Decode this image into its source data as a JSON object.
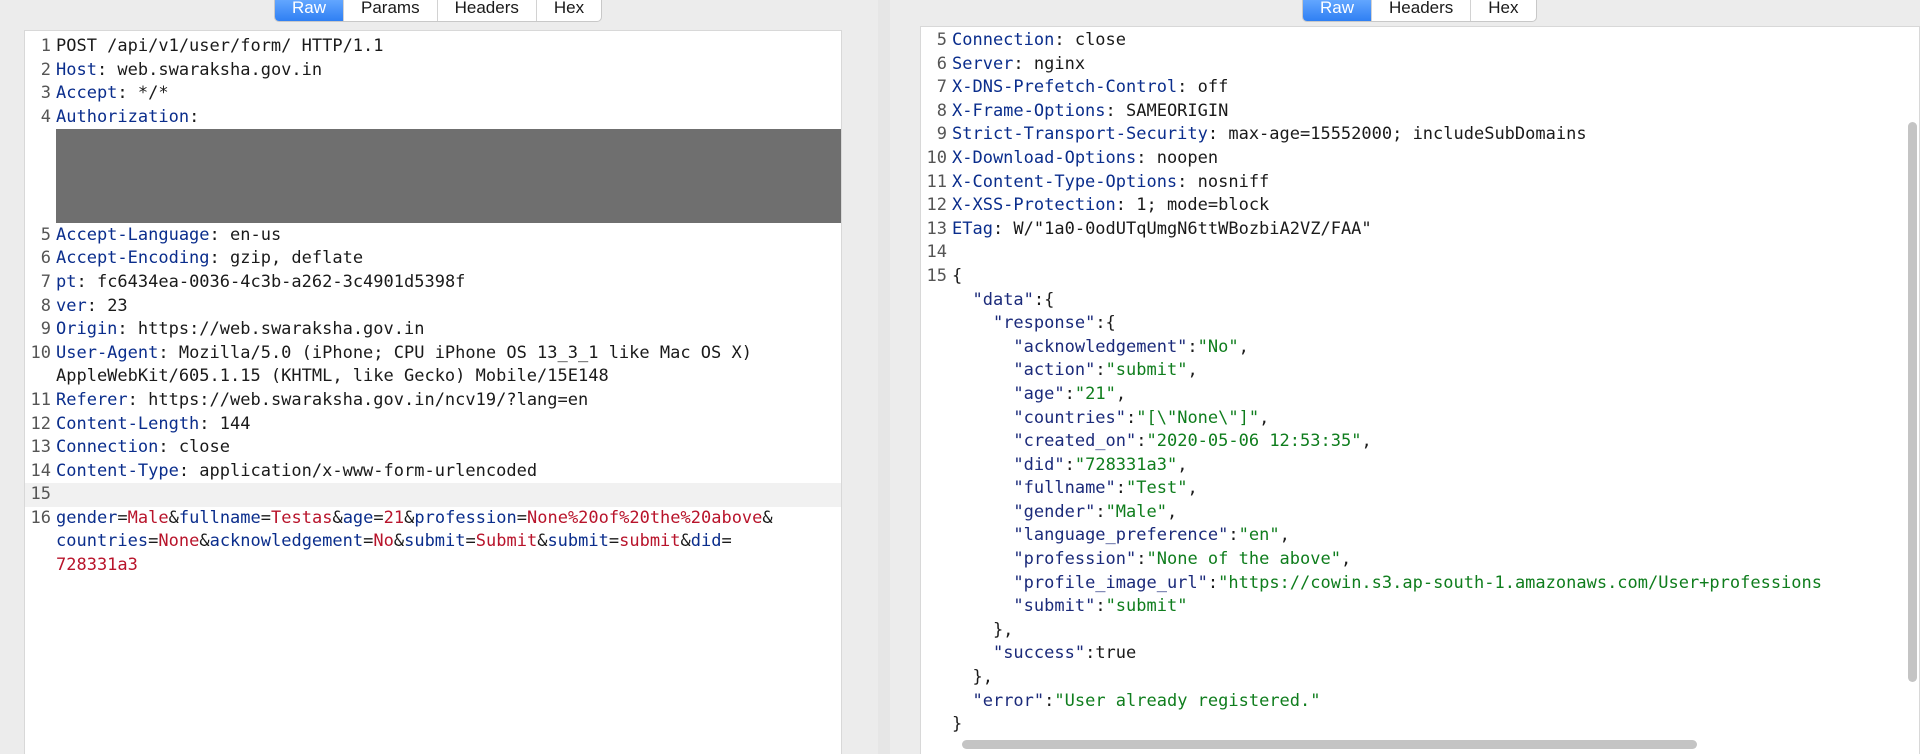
{
  "request": {
    "tabs": [
      "Raw",
      "Params",
      "Headers",
      "Hex"
    ],
    "active_tab": "Raw",
    "lines": [
      {
        "n": "1",
        "segments": [
          {
            "t": "POST /api/v1/user/form/ HTTP/1.1",
            "c": "plain"
          }
        ]
      },
      {
        "n": "2",
        "segments": [
          {
            "t": "Host",
            "c": "k"
          },
          {
            "t": ": web.swaraksha.gov.in",
            "c": "plain"
          }
        ]
      },
      {
        "n": "3",
        "segments": [
          {
            "t": "Accept",
            "c": "k"
          },
          {
            "t": ": */*",
            "c": "plain"
          }
        ]
      },
      {
        "n": "4",
        "segments": [
          {
            "t": "Authorization",
            "c": "k"
          },
          {
            "t": ":",
            "c": "plain"
          }
        ]
      },
      {
        "n": "",
        "redacted": true,
        "segments": []
      },
      {
        "n": "",
        "segments": []
      },
      {
        "n": "",
        "segments": []
      },
      {
        "n": "",
        "segments": []
      },
      {
        "n": "5",
        "segments": [
          {
            "t": "Accept-Language",
            "c": "k"
          },
          {
            "t": ": en-us",
            "c": "plain"
          }
        ]
      },
      {
        "n": "6",
        "segments": [
          {
            "t": "Accept-Encoding",
            "c": "k"
          },
          {
            "t": ": gzip, deflate",
            "c": "plain"
          }
        ]
      },
      {
        "n": "7",
        "segments": [
          {
            "t": "pt",
            "c": "k"
          },
          {
            "t": ": fc6434ea-0036-4c3b-a262-3c4901d5398f",
            "c": "plain"
          }
        ]
      },
      {
        "n": "8",
        "segments": [
          {
            "t": "ver",
            "c": "k"
          },
          {
            "t": ": 23",
            "c": "plain"
          }
        ]
      },
      {
        "n": "9",
        "segments": [
          {
            "t": "Origin",
            "c": "k"
          },
          {
            "t": ": https://web.swaraksha.gov.in",
            "c": "plain"
          }
        ]
      },
      {
        "n": "10",
        "segments": [
          {
            "t": "User-Agent",
            "c": "k"
          },
          {
            "t": ": Mozilla/5.0 (iPhone; CPU iPhone OS 13_3_1 like Mac OS X)",
            "c": "plain"
          }
        ]
      },
      {
        "n": "",
        "segments": [
          {
            "t": "AppleWebKit/605.1.15 (KHTML, like Gecko) Mobile/15E148",
            "c": "plain"
          }
        ]
      },
      {
        "n": "11",
        "segments": [
          {
            "t": "Referer",
            "c": "k"
          },
          {
            "t": ": https://web.swaraksha.gov.in/ncv19/?lang=en",
            "c": "plain"
          }
        ]
      },
      {
        "n": "12",
        "segments": [
          {
            "t": "Content-Length",
            "c": "k"
          },
          {
            "t": ": 144",
            "c": "plain"
          }
        ]
      },
      {
        "n": "13",
        "segments": [
          {
            "t": "Connection",
            "c": "k"
          },
          {
            "t": ": close",
            "c": "plain"
          }
        ]
      },
      {
        "n": "14",
        "segments": [
          {
            "t": "Content-Type",
            "c": "k"
          },
          {
            "t": ": application/x-www-form-urlencoded",
            "c": "plain"
          }
        ]
      },
      {
        "n": "15",
        "highlight": true,
        "segments": []
      },
      {
        "n": "16",
        "segments": [
          {
            "t": "gender",
            "c": "pn"
          },
          {
            "t": "=",
            "c": "plain"
          },
          {
            "t": "Male",
            "c": "pv"
          },
          {
            "t": "&",
            "c": "plain"
          },
          {
            "t": "fullname",
            "c": "pn"
          },
          {
            "t": "=",
            "c": "plain"
          },
          {
            "t": "Testas",
            "c": "pv"
          },
          {
            "t": "&",
            "c": "plain"
          },
          {
            "t": "age",
            "c": "pn"
          },
          {
            "t": "=",
            "c": "plain"
          },
          {
            "t": "21",
            "c": "pv"
          },
          {
            "t": "&",
            "c": "plain"
          },
          {
            "t": "profession",
            "c": "pn"
          },
          {
            "t": "=",
            "c": "plain"
          },
          {
            "t": "None%20of%20the%20above",
            "c": "pv"
          },
          {
            "t": "&",
            "c": "plain"
          }
        ]
      },
      {
        "n": "",
        "segments": [
          {
            "t": "countries",
            "c": "pn"
          },
          {
            "t": "=",
            "c": "plain"
          },
          {
            "t": "None",
            "c": "pv"
          },
          {
            "t": "&",
            "c": "plain"
          },
          {
            "t": "acknowledgement",
            "c": "pn"
          },
          {
            "t": "=",
            "c": "plain"
          },
          {
            "t": "No",
            "c": "pv"
          },
          {
            "t": "&",
            "c": "plain"
          },
          {
            "t": "submit",
            "c": "pn"
          },
          {
            "t": "=",
            "c": "plain"
          },
          {
            "t": "Submit",
            "c": "pv"
          },
          {
            "t": "&",
            "c": "plain"
          },
          {
            "t": "submit",
            "c": "pn"
          },
          {
            "t": "=",
            "c": "plain"
          },
          {
            "t": "submit",
            "c": "pv"
          },
          {
            "t": "&",
            "c": "plain"
          },
          {
            "t": "did",
            "c": "pn"
          },
          {
            "t": "=",
            "c": "plain"
          }
        ]
      },
      {
        "n": "",
        "segments": [
          {
            "t": "728331a3",
            "c": "pv"
          }
        ]
      }
    ]
  },
  "response": {
    "tabs": [
      "Raw",
      "Headers",
      "Hex"
    ],
    "active_tab": "Raw",
    "lines": [
      {
        "n": "5",
        "segments": [
          {
            "t": "Connection",
            "c": "k"
          },
          {
            "t": ": close",
            "c": "plain"
          }
        ]
      },
      {
        "n": "6",
        "segments": [
          {
            "t": "Server",
            "c": "k"
          },
          {
            "t": ": nginx",
            "c": "plain"
          }
        ]
      },
      {
        "n": "7",
        "segments": [
          {
            "t": "X-DNS-Prefetch-Control",
            "c": "k"
          },
          {
            "t": ": off",
            "c": "plain"
          }
        ]
      },
      {
        "n": "8",
        "segments": [
          {
            "t": "X-Frame-Options",
            "c": "k"
          },
          {
            "t": ": SAMEORIGIN",
            "c": "plain"
          }
        ]
      },
      {
        "n": "9",
        "segments": [
          {
            "t": "Strict-Transport-Security",
            "c": "k"
          },
          {
            "t": ": max-age=15552000; includeSubDomains",
            "c": "plain"
          }
        ]
      },
      {
        "n": "10",
        "segments": [
          {
            "t": "X-Download-Options",
            "c": "k"
          },
          {
            "t": ": noopen",
            "c": "plain"
          }
        ]
      },
      {
        "n": "11",
        "segments": [
          {
            "t": "X-Content-Type-Options",
            "c": "k"
          },
          {
            "t": ": nosniff",
            "c": "plain"
          }
        ]
      },
      {
        "n": "12",
        "segments": [
          {
            "t": "X-XSS-Protection",
            "c": "k"
          },
          {
            "t": ": 1; mode=block",
            "c": "plain"
          }
        ]
      },
      {
        "n": "13",
        "segments": [
          {
            "t": "ETag",
            "c": "k"
          },
          {
            "t": ": W/\"1a0-0odUTqUmgN6ttWBozbiA2VZ/FAA\"",
            "c": "plain"
          }
        ]
      },
      {
        "n": "14",
        "segments": []
      },
      {
        "n": "15",
        "segments": [
          {
            "t": "{",
            "c": "plain"
          }
        ]
      },
      {
        "n": "",
        "segments": [
          {
            "t": "  ",
            "c": "plain"
          },
          {
            "t": "\"data\"",
            "c": "jk"
          },
          {
            "t": ":{",
            "c": "plain"
          }
        ]
      },
      {
        "n": "",
        "segments": [
          {
            "t": "    ",
            "c": "plain"
          },
          {
            "t": "\"response\"",
            "c": "jk"
          },
          {
            "t": ":{",
            "c": "plain"
          }
        ]
      },
      {
        "n": "",
        "segments": [
          {
            "t": "      ",
            "c": "plain"
          },
          {
            "t": "\"acknowledgement\"",
            "c": "jk"
          },
          {
            "t": ":",
            "c": "plain"
          },
          {
            "t": "\"No\"",
            "c": "jv"
          },
          {
            "t": ",",
            "c": "plain"
          }
        ]
      },
      {
        "n": "",
        "segments": [
          {
            "t": "      ",
            "c": "plain"
          },
          {
            "t": "\"action\"",
            "c": "jk"
          },
          {
            "t": ":",
            "c": "plain"
          },
          {
            "t": "\"submit\"",
            "c": "jv"
          },
          {
            "t": ",",
            "c": "plain"
          }
        ]
      },
      {
        "n": "",
        "segments": [
          {
            "t": "      ",
            "c": "plain"
          },
          {
            "t": "\"age\"",
            "c": "jk"
          },
          {
            "t": ":",
            "c": "plain"
          },
          {
            "t": "\"21\"",
            "c": "jv"
          },
          {
            "t": ",",
            "c": "plain"
          }
        ]
      },
      {
        "n": "",
        "segments": [
          {
            "t": "      ",
            "c": "plain"
          },
          {
            "t": "\"countries\"",
            "c": "jk"
          },
          {
            "t": ":",
            "c": "plain"
          },
          {
            "t": "\"[\\\"None\\\"]\"",
            "c": "jv"
          },
          {
            "t": ",",
            "c": "plain"
          }
        ]
      },
      {
        "n": "",
        "segments": [
          {
            "t": "      ",
            "c": "plain"
          },
          {
            "t": "\"created_on\"",
            "c": "jk"
          },
          {
            "t": ":",
            "c": "plain"
          },
          {
            "t": "\"2020-05-06 12:53:35\"",
            "c": "jv"
          },
          {
            "t": ",",
            "c": "plain"
          }
        ]
      },
      {
        "n": "",
        "segments": [
          {
            "t": "      ",
            "c": "plain"
          },
          {
            "t": "\"did\"",
            "c": "jk"
          },
          {
            "t": ":",
            "c": "plain"
          },
          {
            "t": "\"728331a3\"",
            "c": "jv"
          },
          {
            "t": ",",
            "c": "plain"
          }
        ]
      },
      {
        "n": "",
        "segments": [
          {
            "t": "      ",
            "c": "plain"
          },
          {
            "t": "\"fullname\"",
            "c": "jk"
          },
          {
            "t": ":",
            "c": "plain"
          },
          {
            "t": "\"Test\"",
            "c": "jv"
          },
          {
            "t": ",",
            "c": "plain"
          }
        ]
      },
      {
        "n": "",
        "segments": [
          {
            "t": "      ",
            "c": "plain"
          },
          {
            "t": "\"gender\"",
            "c": "jk"
          },
          {
            "t": ":",
            "c": "plain"
          },
          {
            "t": "\"Male\"",
            "c": "jv"
          },
          {
            "t": ",",
            "c": "plain"
          }
        ]
      },
      {
        "n": "",
        "segments": [
          {
            "t": "      ",
            "c": "plain"
          },
          {
            "t": "\"language_preference\"",
            "c": "jk"
          },
          {
            "t": ":",
            "c": "plain"
          },
          {
            "t": "\"en\"",
            "c": "jv"
          },
          {
            "t": ",",
            "c": "plain"
          }
        ]
      },
      {
        "n": "",
        "segments": [
          {
            "t": "      ",
            "c": "plain"
          },
          {
            "t": "\"profession\"",
            "c": "jk"
          },
          {
            "t": ":",
            "c": "plain"
          },
          {
            "t": "\"None of the above\"",
            "c": "jv"
          },
          {
            "t": ",",
            "c": "plain"
          }
        ]
      },
      {
        "n": "",
        "segments": [
          {
            "t": "      ",
            "c": "plain"
          },
          {
            "t": "\"profile_image_url\"",
            "c": "jk"
          },
          {
            "t": ":",
            "c": "plain"
          },
          {
            "t": "\"https://cowin.s3.ap-south-1.amazonaws.com/User+professions",
            "c": "jv"
          }
        ]
      },
      {
        "n": "",
        "segments": [
          {
            "t": "      ",
            "c": "plain"
          },
          {
            "t": "\"submit\"",
            "c": "jk"
          },
          {
            "t": ":",
            "c": "plain"
          },
          {
            "t": "\"submit\"",
            "c": "jv"
          }
        ]
      },
      {
        "n": "",
        "segments": [
          {
            "t": "    },",
            "c": "plain"
          }
        ]
      },
      {
        "n": "",
        "segments": [
          {
            "t": "    ",
            "c": "plain"
          },
          {
            "t": "\"success\"",
            "c": "jk"
          },
          {
            "t": ":true",
            "c": "plain"
          }
        ]
      },
      {
        "n": "",
        "segments": [
          {
            "t": "  },",
            "c": "plain"
          }
        ]
      },
      {
        "n": "",
        "segments": [
          {
            "t": "  ",
            "c": "plain"
          },
          {
            "t": "\"error\"",
            "c": "jk"
          },
          {
            "t": ":",
            "c": "plain"
          },
          {
            "t": "\"User already registered.\"",
            "c": "jv"
          }
        ]
      },
      {
        "n": "",
        "segments": [
          {
            "t": "}",
            "c": "plain"
          }
        ]
      }
    ]
  }
}
